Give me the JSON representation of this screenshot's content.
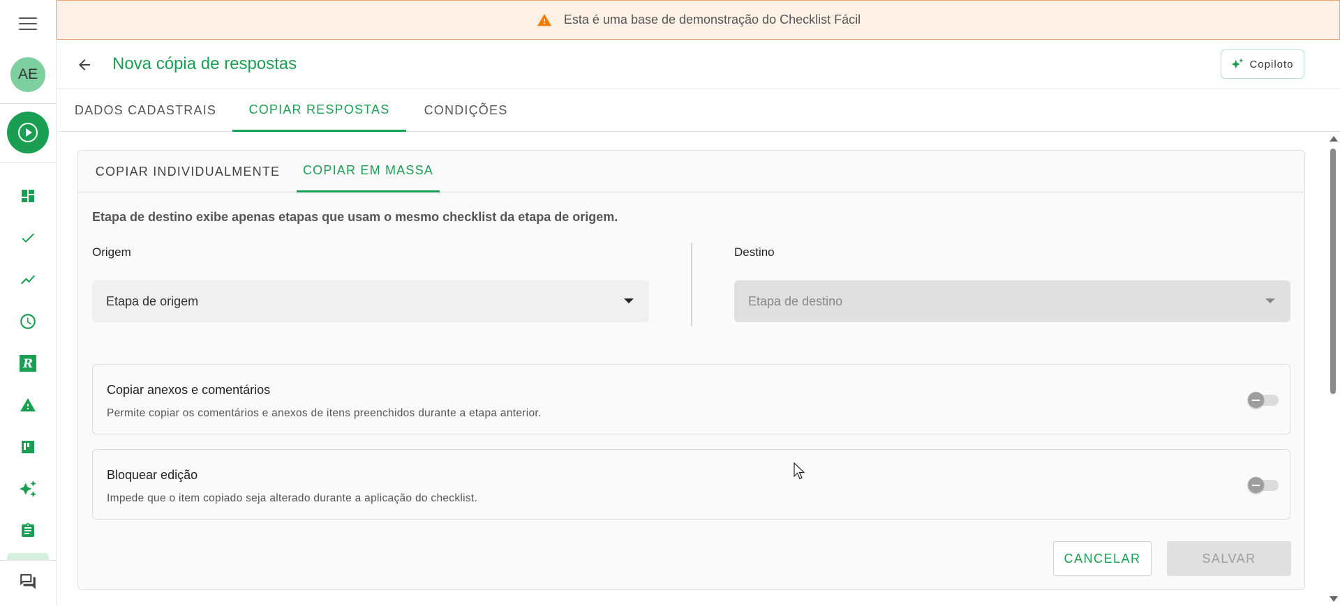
{
  "banner": {
    "text": "Esta é uma base de demonstração do Checklist Fácil",
    "icon": "warning-icon",
    "color": "#f57c00"
  },
  "sidebar": {
    "avatar_initials": "AE",
    "items": [
      {
        "icon": "dashboard-icon"
      },
      {
        "icon": "check-icon"
      },
      {
        "icon": "analytics-icon"
      },
      {
        "icon": "clock-icon"
      },
      {
        "icon": "r-logo-icon"
      },
      {
        "icon": "alert-triangle-icon"
      },
      {
        "icon": "kanban-icon"
      },
      {
        "icon": "sparkle-icon"
      },
      {
        "icon": "clipboard-icon"
      }
    ],
    "bottom_icon": "chat-icon"
  },
  "header": {
    "title": "Nova cópia de respostas",
    "copiloto_label": "Copiloto"
  },
  "main_tabs": [
    {
      "label": "DADOS CADASTRAIS",
      "active": false
    },
    {
      "label": "COPIAR RESPOSTAS",
      "active": true
    },
    {
      "label": "CONDIÇÕES",
      "active": false
    }
  ],
  "sub_tabs": [
    {
      "label": "COPIAR INDIVIDUALMENTE",
      "active": false
    },
    {
      "label": "COPIAR EM MASSA",
      "active": true
    }
  ],
  "form": {
    "info": "Etapa de destino exibe apenas etapas que usam o mesmo checklist da etapa de origem.",
    "origin_label": "Origem",
    "origin_placeholder": "Etapa de origem",
    "dest_label": "Destino",
    "dest_placeholder": "Etapa de destino",
    "options": [
      {
        "title": "Copiar anexos e comentários",
        "desc": "Permite copiar os comentários e anexos de itens preenchidos durante a etapa anterior.",
        "enabled": false
      },
      {
        "title": "Bloquear edição",
        "desc": "Impede que o item copiado seja alterado durante a aplicação do checklist.",
        "enabled": false
      }
    ],
    "cancel_label": "CANCELAR",
    "save_label": "SALVAR"
  },
  "colors": {
    "brand": "#1a9f52",
    "banner_bg": "#fef1e6",
    "banner_border": "#f5a266"
  }
}
